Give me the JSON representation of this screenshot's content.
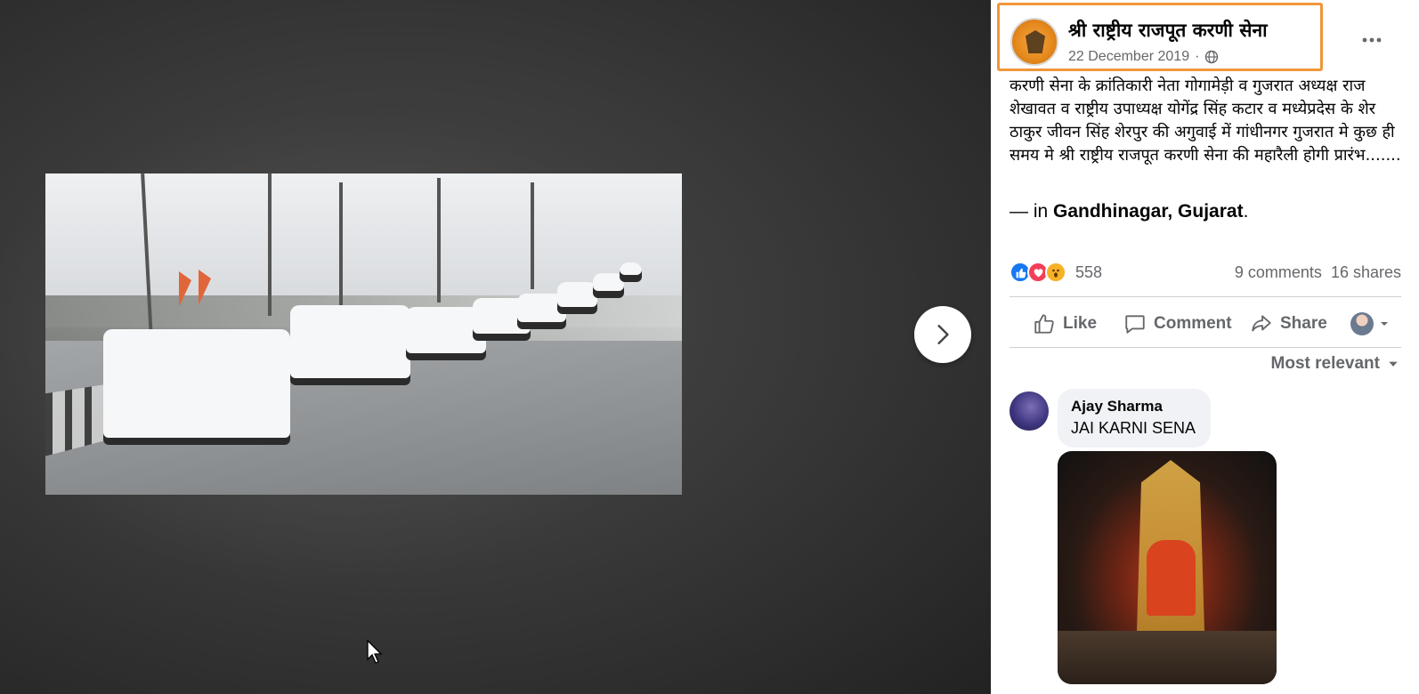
{
  "post": {
    "page_name": "श्री राष्ट्रीय राजपूत करणी सेना",
    "date": "22 December 2019",
    "separator": "·",
    "text": "करणी सेना के क्रांतिकारी नेता गोगामेड़ी व गुजरात अध्यक्ष राज शेखावत व राष्ट्रीय उपाध्यक्ष योगेंद्र सिंह कटार व मध्येप्रदेस के शेर ठाकुर जीवन सिंह शेरपुर की अगुवाई में गांधीनगर गुजरात मे कुछ ही समय मे श्री राष्ट्रीय राजपूत करणी सेना की महारैली होगी प्रारंभ.......",
    "location_prefix": "— in ",
    "location": "Gandhinagar, Gujarat",
    "location_suffix": "."
  },
  "engagement": {
    "reaction_count": "558",
    "comments": "9 comments",
    "shares": "16 shares",
    "reaction_types": [
      "like",
      "love",
      "wow"
    ]
  },
  "actions": {
    "like": "Like",
    "comment": "Comment",
    "share": "Share"
  },
  "sort": {
    "label": "Most relevant"
  },
  "comments": [
    {
      "author": "Ajay Sharma",
      "text": "JAI KARNI SENA"
    }
  ],
  "icons": {
    "next": "chevron-right-icon",
    "more": "more-horizontal-icon",
    "globe": "globe-icon",
    "like": "thumbs-up-icon",
    "comment": "comment-icon",
    "share": "share-icon",
    "dropdown": "chevron-down-icon"
  },
  "colors": {
    "highlight_border": "#f0963a",
    "link_blue": "#1877f2",
    "love_red": "#f33e58",
    "wow_yellow": "#f7b125",
    "secondary_text": "#65676b"
  }
}
